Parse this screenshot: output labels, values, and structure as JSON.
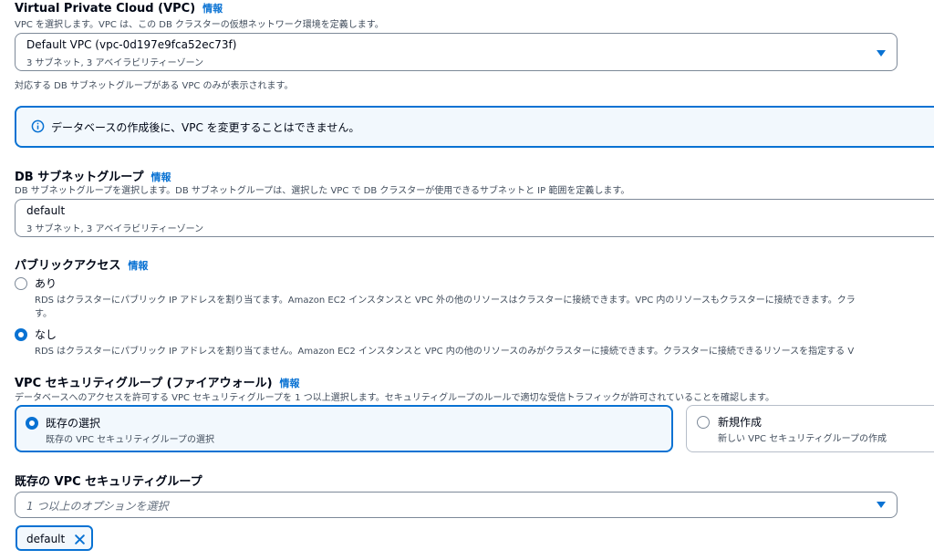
{
  "vpc": {
    "title": "Virtual Private Cloud (VPC)",
    "info": "情報",
    "description": "VPC を選択します。VPC は、この DB クラスターの仮想ネットワーク環境を定義します。",
    "selected_value": "Default VPC (vpc-0d197e9fca52ec73f)",
    "selected_sub": "3 サブネット, 3 アベイラビリティーゾーン",
    "hint": "対応する DB サブネットグループがある VPC のみが表示されます。",
    "alert_text": "データベースの作成後に、VPC を変更することはできません。"
  },
  "subnet_group": {
    "title": "DB サブネットグループ",
    "info": "情報",
    "description": "DB サブネットグループを選択します。DB サブネットグループは、選択した VPC で DB クラスターが使用できるサブネットと IP 範囲を定義します。",
    "selected_value": "default",
    "selected_sub": "3 サブネット, 3 アベイラビリティーゾーン"
  },
  "public_access": {
    "title": "パブリックアクセス",
    "info": "情報",
    "options": [
      {
        "label": "あり",
        "description": "RDS はクラスターにパブリック IP アドレスを割り当てます。Amazon EC2 インスタンスと VPC 外の他のリソースはクラスターに接続できます。VPC 内のリソースもクラスターに接続できます。クラ",
        "description_wrap": "す。",
        "selected": false
      },
      {
        "label": "なし",
        "description": "RDS はクラスターにパブリック IP アドレスを割り当てません。Amazon EC2 インスタンスと VPC 内の他のリソースのみがクラスターに接続できます。クラスターに接続できるリソースを指定する V",
        "selected": true
      }
    ]
  },
  "security_group": {
    "title": "VPC セキュリティグループ (ファイアウォール)",
    "info": "情報",
    "description": "データベースへのアクセスを許可する VPC セキュリティグループを 1 つ以上選択します。セキュリティグループのルールで適切な受信トラフィックが許可されていることを確認します。",
    "tiles": [
      {
        "label": "既存の選択",
        "description": "既存の VPC セキュリティグループの選択",
        "selected": true
      },
      {
        "label": "新規作成",
        "description": "新しい VPC セキュリティグループの作成",
        "selected": false
      }
    ]
  },
  "existing_groups": {
    "title": "既存の VPC セキュリティグループ",
    "placeholder": "1 つ以上のオプションを選択",
    "token": "default"
  },
  "colors": {
    "accent": "#0972d3",
    "text": "#000716",
    "secondary_text": "#414d5c",
    "alert_bg": "#f2f8fd"
  }
}
